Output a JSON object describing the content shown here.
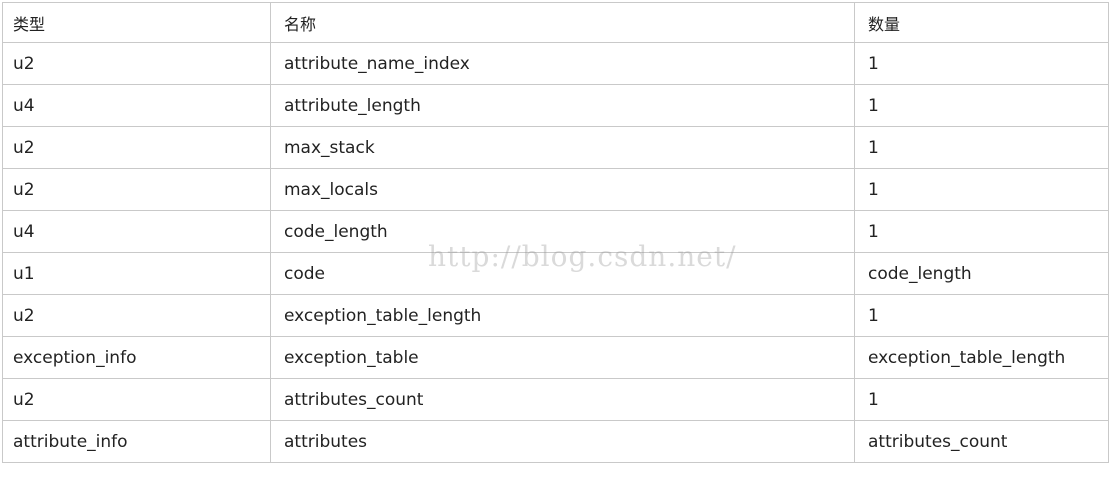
{
  "table": {
    "headers": [
      "类型",
      "名称",
      "数量"
    ],
    "rows": [
      [
        "u2",
        "attribute_name_index",
        "1"
      ],
      [
        "u4",
        "attribute_length",
        "1"
      ],
      [
        "u2",
        "max_stack",
        "1"
      ],
      [
        "u2",
        "max_locals",
        "1"
      ],
      [
        "u4",
        "code_length",
        "1"
      ],
      [
        "u1",
        "code",
        "code_length"
      ],
      [
        "u2",
        "exception_table_length",
        "1"
      ],
      [
        "exception_info",
        "exception_table",
        "exception_table_length"
      ],
      [
        "u2",
        "attributes_count",
        "1"
      ],
      [
        "attribute_info",
        "attributes",
        "attributes_count"
      ]
    ]
  },
  "watermark": "http://blog.csdn.net/",
  "colors": {
    "border": "#c9c9c9",
    "text": "#222222",
    "watermark": "#969696"
  }
}
